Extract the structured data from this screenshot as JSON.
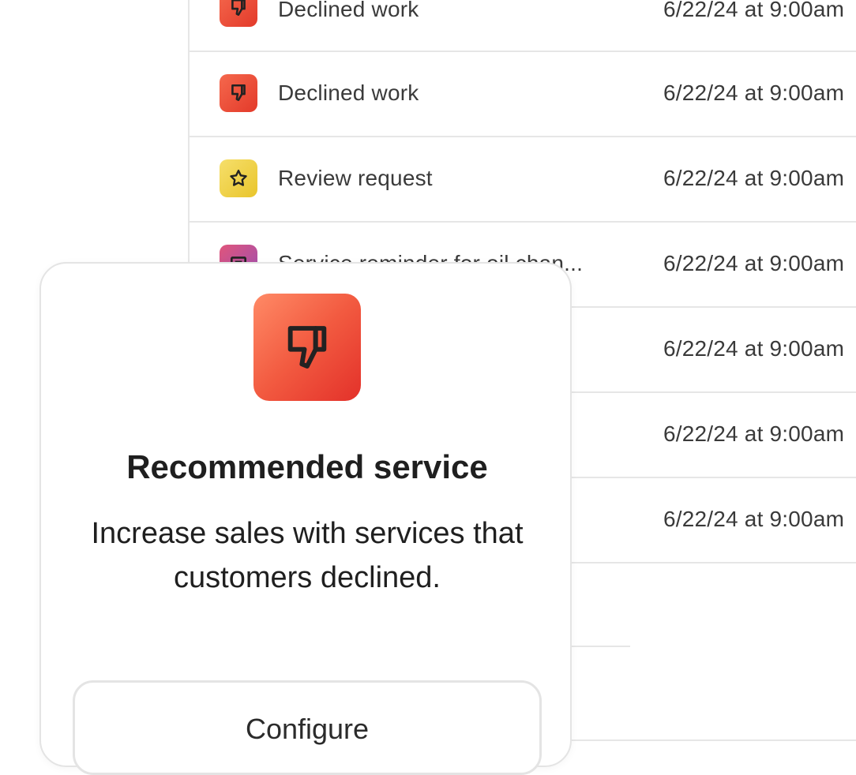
{
  "activity_list": {
    "rows": [
      {
        "label": "Declined work",
        "time": "6/22/24 at 9:00am",
        "icon": "thumbs-down-icon"
      },
      {
        "label": "Declined work",
        "time": "6/22/24 at 9:00am",
        "icon": "thumbs-down-icon"
      },
      {
        "label": "Review request",
        "time": "6/22/24 at 9:00am",
        "icon": "star-icon"
      },
      {
        "label": "Service reminder for oil chan...",
        "time": "6/22/24 at 9:00am",
        "icon": "message-icon"
      },
      {
        "label": "",
        "time": "6/22/24 at 9:00am"
      },
      {
        "label": "",
        "time": "6/22/24 at 9:00am"
      },
      {
        "label": "",
        "time": "6/22/24 at 9:00am"
      }
    ]
  },
  "feature_card": {
    "icon": "thumbs-down-icon",
    "title": "Recommended service",
    "description": "Increase sales with services that customers declined.",
    "configure_label": "Configure"
  },
  "colors": {
    "declined_icon": "#e9432f",
    "review_icon": "#f0d34a",
    "reminder_icon": "#b24f9a",
    "divider": "#e6e6e6"
  }
}
